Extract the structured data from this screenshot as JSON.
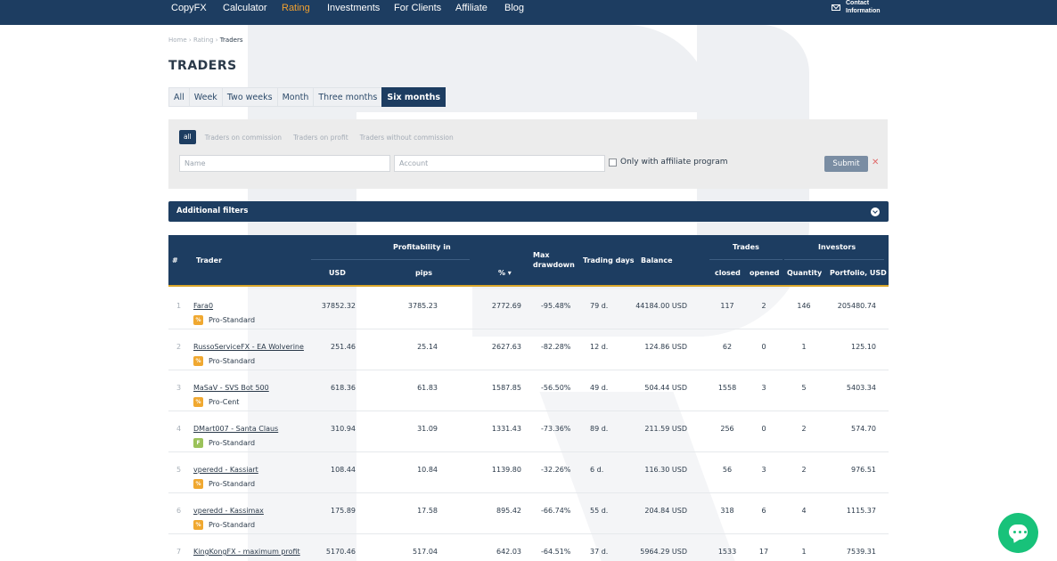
{
  "nav": {
    "items": [
      "CopyFX",
      "Calculator",
      "Rating",
      "Investments",
      "For Clients",
      "Affiliate",
      "Blog"
    ],
    "active_index": 2,
    "contact_line1": "Contact",
    "contact_line2": "Information"
  },
  "breadcrumb": [
    "Home",
    "Rating",
    "Traders"
  ],
  "page_title": "TRADERS",
  "periods": [
    "All",
    "Week",
    "Two weeks",
    "Month",
    "Three months",
    "Six months"
  ],
  "active_period": "Six months",
  "filters": {
    "tabs": [
      "all",
      "Traders on commission",
      "Traders on profit",
      "Traders without commission"
    ],
    "active_tab": "all",
    "name_placeholder": "Name",
    "account_placeholder": "Account",
    "affiliate_label": "Only with affiliate program",
    "submit_label": "Submit",
    "clear_label": "✕"
  },
  "additional_filters_label": "Additional filters",
  "table": {
    "headers": {
      "num": "#",
      "trader": "Trader",
      "profitability": "Profitability in",
      "usd": "USD",
      "pips": "pips",
      "pct": "% ▾",
      "max_drawdown_1": "Max",
      "max_drawdown_2": "drawdown",
      "trading_days": "Trading days",
      "balance": "Balance",
      "trades": "Trades",
      "closed": "closed",
      "opened": "opened",
      "investors": "Investors",
      "quantity": "Quantity",
      "portfolio": "Portfolio, USD"
    },
    "rows": [
      {
        "num": "1",
        "name": "Fara0",
        "account": "Pro-Standard",
        "badge": "%",
        "badge_color": "#f0a830",
        "usd": "37852.32",
        "pips": "3785.23",
        "pct": "2772.69",
        "drawdown": "-95.48%",
        "days": "79 d.",
        "balance": "44184.00 USD",
        "closed": "117",
        "opened": "2",
        "quantity": "146",
        "portfolio": "205480.74"
      },
      {
        "num": "2",
        "name": "RussoServiceFX - EA Wolverine",
        "account": "Pro-Standard",
        "badge": "%",
        "badge_color": "#f0a830",
        "usd": "251.46",
        "pips": "25.14",
        "pct": "2627.63",
        "drawdown": "-82.28%",
        "days": "12 d.",
        "balance": "124.86 USD",
        "closed": "62",
        "opened": "0",
        "quantity": "1",
        "portfolio": "125.10"
      },
      {
        "num": "3",
        "name": "MaSaV - SVS Bot 500",
        "account": "Pro-Cent",
        "badge": "%",
        "badge_color": "#f0a830",
        "usd": "618.36",
        "pips": "61.83",
        "pct": "1587.85",
        "drawdown": "-56.50%",
        "days": "49 d.",
        "balance": "504.44 USD",
        "closed": "1558",
        "opened": "3",
        "quantity": "5",
        "portfolio": "5403.34"
      },
      {
        "num": "4",
        "name": "DMart007 - Santa Claus",
        "account": "Pro-Standard",
        "badge": "F",
        "badge_color": "#9bc25a",
        "usd": "310.94",
        "pips": "31.09",
        "pct": "1331.43",
        "drawdown": "-73.36%",
        "days": "89 d.",
        "balance": "211.59 USD",
        "closed": "256",
        "opened": "0",
        "quantity": "2",
        "portfolio": "574.70"
      },
      {
        "num": "5",
        "name": "vperedd - Kassiart",
        "account": "Pro-Standard",
        "badge": "%",
        "badge_color": "#f0a830",
        "usd": "108.44",
        "pips": "10.84",
        "pct": "1139.80",
        "drawdown": "-32.26%",
        "days": "6 d.",
        "balance": "116.30 USD",
        "closed": "56",
        "opened": "3",
        "quantity": "2",
        "portfolio": "976.51"
      },
      {
        "num": "6",
        "name": "vperedd - Kassimax",
        "account": "Pro-Standard",
        "badge": "%",
        "badge_color": "#f0a830",
        "usd": "175.89",
        "pips": "17.58",
        "pct": "895.42",
        "drawdown": "-66.74%",
        "days": "55 d.",
        "balance": "204.84 USD",
        "closed": "318",
        "opened": "6",
        "quantity": "4",
        "portfolio": "1115.37"
      },
      {
        "num": "7",
        "name": "KingKongFX - maximum profit",
        "account": "",
        "badge": "",
        "badge_color": "#f0a830",
        "usd": "5170.46",
        "pips": "517.04",
        "pct": "642.03",
        "drawdown": "-64.51%",
        "days": "37 d.",
        "balance": "5964.29 USD",
        "closed": "1533",
        "opened": "17",
        "quantity": "1",
        "portfolio": "7539.31"
      }
    ]
  },
  "colors": {
    "navy": "#1d3d61",
    "accent_orange": "#f0a030",
    "chat_green": "#18c27a"
  },
  "chat_icon": "chat-bubble-icon"
}
